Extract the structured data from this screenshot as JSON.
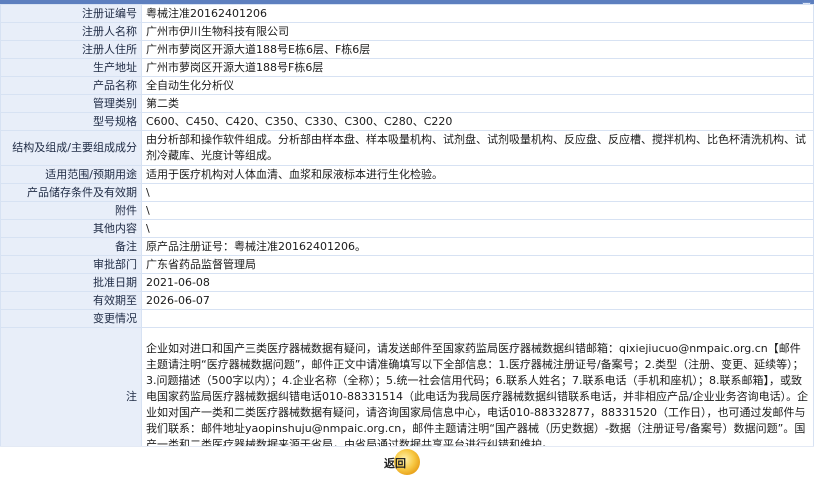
{
  "rows": [
    {
      "label": "注册证编号",
      "value": "粤械注准20162401206"
    },
    {
      "label": "注册人名称",
      "value": "广州市伊川生物科技有限公司"
    },
    {
      "label": "注册人住所",
      "value": "广州市萝岗区开源大道188号E栋6层、F栋6层"
    },
    {
      "label": "生产地址",
      "value": "广州市萝岗区开源大道188号F栋6层"
    },
    {
      "label": "产品名称",
      "value": "全自动生化分析仪"
    },
    {
      "label": "管理类别",
      "value": "第二类"
    },
    {
      "label": "型号规格",
      "value": "C600、C450、C420、C350、C330、C300、C280、C220"
    },
    {
      "label": "结构及组成/主要组成成分",
      "value": "由分析部和操作软件组成。分析部由样本盘、样本吸量机构、试剂盘、试剂吸量机构、反应盘、反应槽、搅拌机构、比色杯清洗机构、试剂冷藏库、光度计等组成。"
    },
    {
      "label": "适用范围/预期用途",
      "value": "适用于医疗机构对人体血清、血浆和尿液标本进行生化检验。"
    },
    {
      "label": "产品储存条件及有效期",
      "value": "\\"
    },
    {
      "label": "附件",
      "value": "\\"
    },
    {
      "label": "其他内容",
      "value": "\\"
    },
    {
      "label": "备注",
      "value": "原产品注册证号：粤械注准20162401206。"
    },
    {
      "label": "审批部门",
      "value": "广东省药品监督管理局"
    },
    {
      "label": "批准日期",
      "value": "2021-06-08"
    },
    {
      "label": "有效期至",
      "value": "2026-06-07"
    },
    {
      "label": "变更情况",
      "value": ""
    }
  ],
  "note": {
    "label": "注",
    "text": "企业如对进口和国产三类医疗器械数据有疑问，请发送邮件至国家药监局医疗器械数据纠错邮箱：qixiejiucuo@nmpaic.org.cn【邮件主题请注明“医疗器械数据问题”，邮件正文中请准确填写以下全部信息：1.医疗器械注册证号/备案号；2.类型（注册、变更、延续等）；3.问题描述（500字以内）；4.企业名称（全称）；5.统一社会信用代码；6.联系人姓名；7.联系电话（手机和座机）；8.联系邮箱】，或致电国家药监局医疗器械数据纠错电话010-88331514（此电话为我局医疗器械数据纠错联系电话，并非相应产品/企业业务咨询电话）。企业如对国产一类和二类医疗器械数据有疑问，请咨询国家局信息中心，电话010-88332877，88331520（工作日），也可通过发邮件与我们联系：邮件地址yaopinshuju@nmpaic.org.cn，邮件主题请注明“国产器械（历史数据）-数据（注册证号/备案号）数据问题”。国产一类和二类医疗器械数据来源于省局，由省局通过数据共享平台进行纠错和维护。"
  },
  "return_label": "返回",
  "icons": {
    "corner": "close-icon",
    "return": "return-icon"
  },
  "colors": {
    "label_bg": "#e8eef9",
    "border": "#d7e2f3",
    "accent": "#5d7fbf"
  }
}
